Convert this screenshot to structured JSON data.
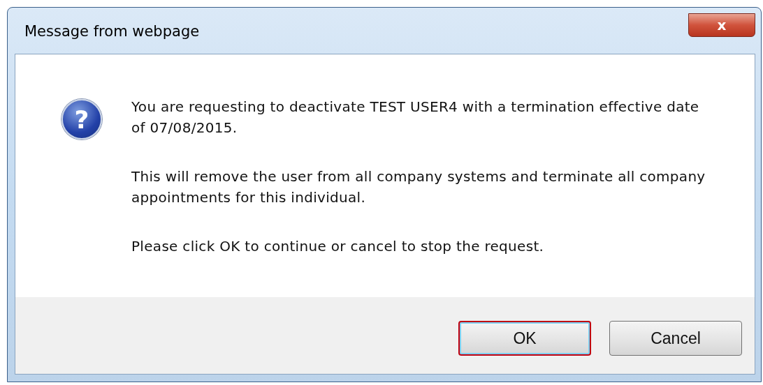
{
  "window": {
    "title": "Message from webpage",
    "close_glyph": "x"
  },
  "message": {
    "icon_glyph": "?",
    "paragraphs": [
      "You are requesting to deactivate TEST USER4 with a termination effective date of 07/08/2015.",
      "This will remove the user from all company systems and terminate all company appointments for this individual.",
      "Please click OK to continue or cancel to stop the request."
    ]
  },
  "buttons": [
    {
      "label": "OK",
      "highlighted": true
    },
    {
      "label": "Cancel",
      "highlighted": false
    }
  ]
}
